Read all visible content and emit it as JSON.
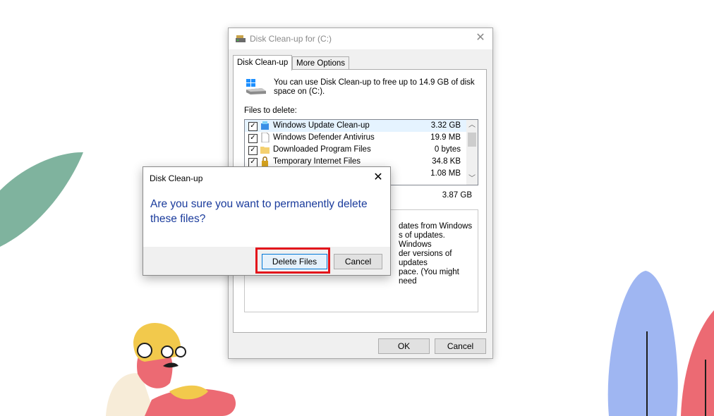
{
  "main_window": {
    "title": "Disk Clean-up for  (C:)",
    "close_glyph": "✕",
    "tabs": [
      {
        "label": "Disk Clean-up",
        "active": true
      },
      {
        "label": "More Options",
        "active": false
      }
    ],
    "intro_text": "You can use Disk Clean-up to free up to 14.9 GB of disk space on  (C:).",
    "files_to_delete_label": "Files to delete:",
    "files": [
      {
        "checked": true,
        "name": "Windows Update Clean-up",
        "size": "3.32 GB",
        "icon": "windows-update-icon"
      },
      {
        "checked": true,
        "name": "Windows Defender Antivirus",
        "size": "19.9 MB",
        "icon": "document-icon"
      },
      {
        "checked": true,
        "name": "Downloaded Program Files",
        "size": "0 bytes",
        "icon": "folder-icon"
      },
      {
        "checked": true,
        "name": "Temporary Internet Files",
        "size": "34.8 KB",
        "icon": "lock-icon"
      },
      {
        "checked": false,
        "name": "",
        "size": "1.08 MB",
        "icon": ""
      }
    ],
    "total_gained": "3.87 GB",
    "description_partial": "dates from Windows\ns of updates. Windows\nder versions of updates\npace. (You might need",
    "ok_label": "OK",
    "cancel_label": "Cancel"
  },
  "confirm_dialog": {
    "title": "Disk Clean-up",
    "close_glyph": "✕",
    "question": "Are you sure you want to permanently delete these files?",
    "delete_label": "Delete Files",
    "cancel_label": "Cancel"
  },
  "colors": {
    "highlight": "#e3141b",
    "question_text": "#1a3b9c",
    "leaf_green": "#7fb39e",
    "plant_blue": "#9fb6f2",
    "plant_red": "#ec6a73",
    "helmet_yellow": "#f2c94c",
    "skin_pink": "#ec6a73"
  }
}
